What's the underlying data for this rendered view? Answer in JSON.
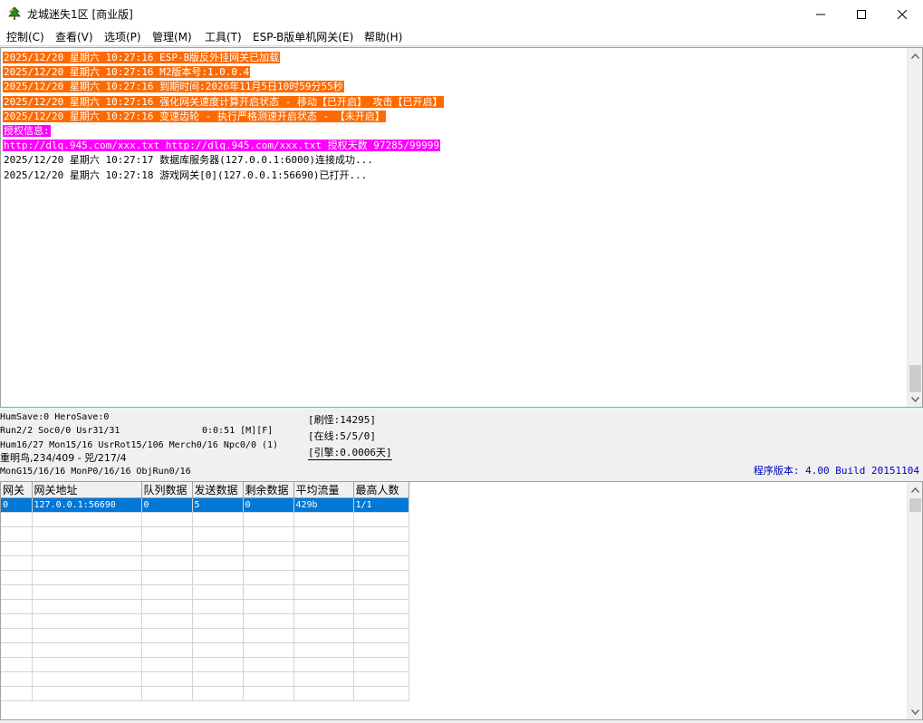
{
  "window": {
    "title": "龙城迷失1区 [商业版]"
  },
  "menu": [
    "控制(C)",
    "查看(V)",
    "选项(P)",
    "管理(M)",
    "工具(T)",
    "ESP-B版单机网关(E)",
    "帮助(H)"
  ],
  "log": {
    "lines": [
      {
        "text": "2025/12/20 星期六 10:27:16 ESP-B版反外挂网关已加载",
        "style": "orange"
      },
      {
        "text": "2025/12/20 星期六 10:27:16 M2版本号:1.0.0.4",
        "style": "orange"
      },
      {
        "text": "2025/12/20 星期六 10:27:16 到期时间:2026年11月5日10时59分55秒",
        "style": "orange"
      },
      {
        "text": "2025/12/20 星期六 10:27:16 强化网关速度计算开启状态 - 移动【已开启】 攻击【已开启】",
        "style": "orange"
      },
      {
        "text": "2025/12/20 星期六 10:27:16 变速齿轮 - 执行严格测速开启状态 - 【未开启】",
        "style": "orange"
      },
      {
        "text": "授权信息:",
        "style": "magenta"
      },
      {
        "text": "http://dlq.945.com/xxx.txt http://dlq.945.com/xxx.txt 授权天数 97285/99999",
        "style": "magenta"
      },
      {
        "text": "2025/12/20 星期六 10:27:17 数据库服务器(127.0.0.1:6000)连接成功...",
        "style": "plain"
      },
      {
        "text": "2025/12/20 星期六 10:27:18 游戏网关[0](127.0.0.1:56690)已打开...",
        "style": "plain"
      }
    ]
  },
  "status": {
    "line1": "HumSave:0 HeroSave:0",
    "line2a": "Run2/2 Soc0/0 Usr31/31",
    "line2b": "0:0:51 [M][F]",
    "line3": "Hum16/27 Mon15/16 UsrRot15/106 Merch0/16 Npc0/0 (1)",
    "line4": "重明鸟,234/409 - 兕/217/4",
    "line5": "MonG15/16/16 MonP0/16/16 ObjRun0/16",
    "refresh": "[刷怪:14295]",
    "online": "[在线:5/5/0]",
    "engine": "[引擎:0.0006天]",
    "version": "程序版本: 4.00 Build 20151104"
  },
  "table": {
    "headers": [
      "网关",
      "网关地址",
      "队列数据",
      "发送数据",
      "剩余数据",
      "平均流量",
      "最高人数"
    ],
    "rows": [
      [
        "0",
        "127.0.0.1:56690",
        "0",
        "5",
        "0",
        "429b",
        "1/1"
      ]
    ]
  },
  "colors": {
    "orange_highlight": "#ff6a00",
    "magenta_highlight": "#ff00ff",
    "selection": "#0078d7",
    "version_text": "#0000c0"
  }
}
